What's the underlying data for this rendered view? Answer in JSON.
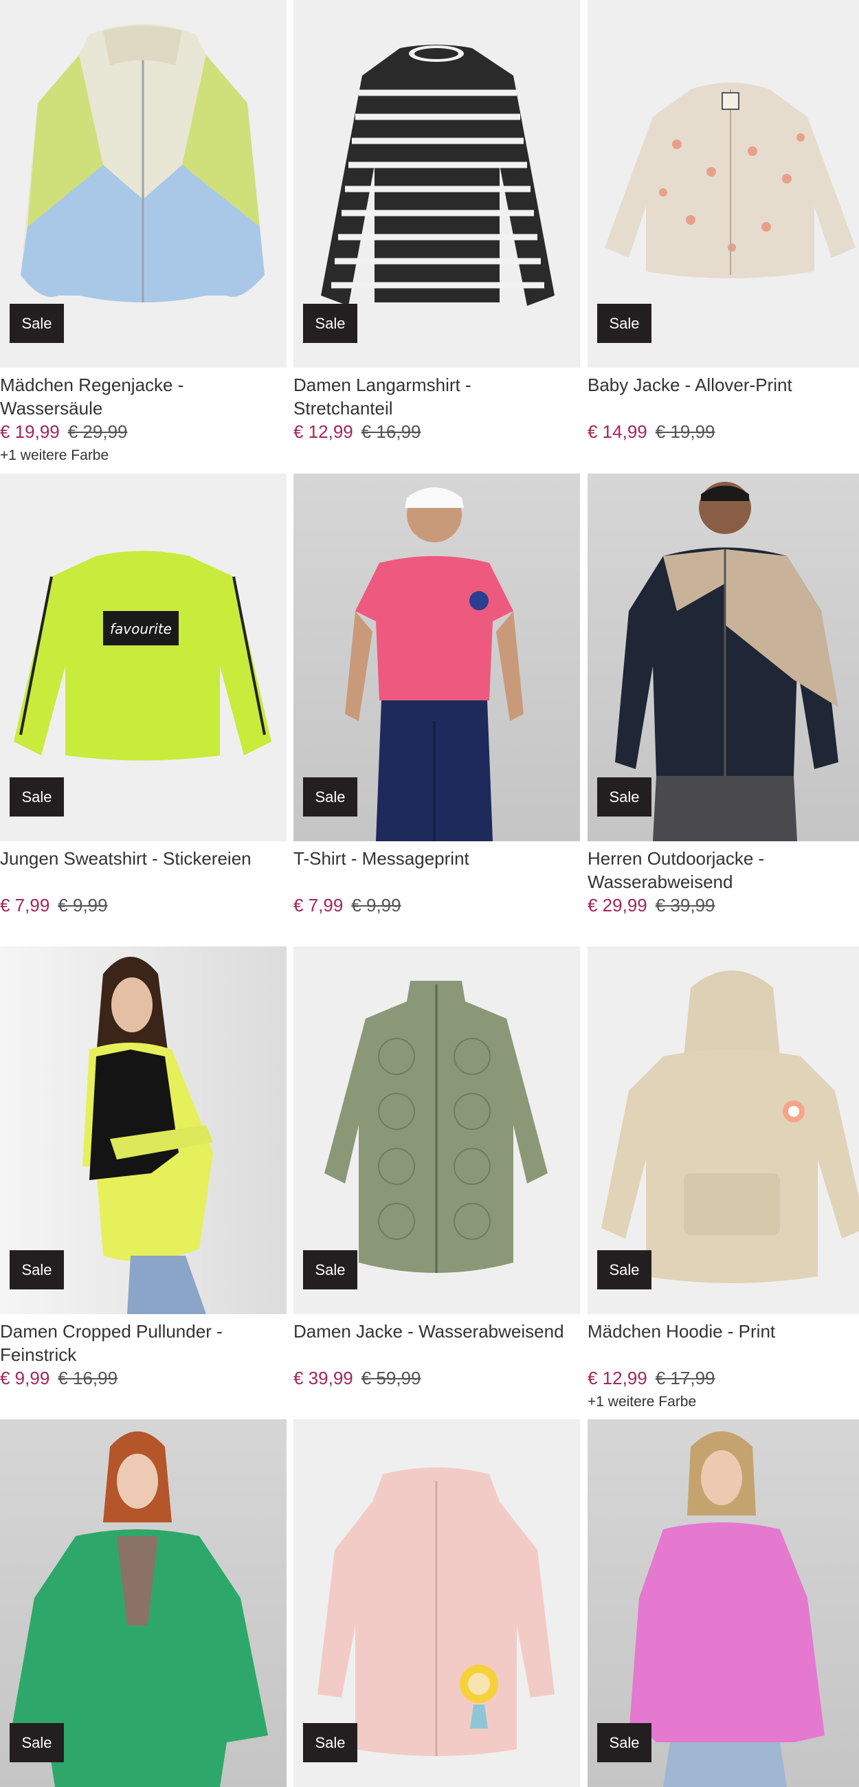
{
  "sale_label": "Sale",
  "products": [
    {
      "title": "Mädchen Regenjacke - Wassersäule",
      "price": "€ 19,99",
      "old_price": "€ 29,99",
      "more": "+1 weitere Farbe"
    },
    {
      "title": "Damen Langarmshirt - Stretchanteil",
      "price": "€ 12,99",
      "old_price": "€ 16,99",
      "more": ""
    },
    {
      "title": "Baby Jacke - Allover-Print",
      "price": "€ 14,99",
      "old_price": "€ 19,99",
      "more": ""
    },
    {
      "title": "Jungen Sweatshirt - Stickereien",
      "price": "€ 7,99",
      "old_price": "€ 9,99",
      "more": ""
    },
    {
      "title": "T-Shirt - Messageprint",
      "price": "€ 7,99",
      "old_price": "€ 9,99",
      "more": ""
    },
    {
      "title": "Herren Outdoorjacke - Wasserabweisend",
      "price": "€ 29,99",
      "old_price": "€ 39,99",
      "more": ""
    },
    {
      "title": "Damen Cropped Pullunder - Feinstrick",
      "price": "€ 9,99",
      "old_price": "€ 16,99",
      "more": ""
    },
    {
      "title": "Damen Jacke - Wasserabweisend",
      "price": "€ 39,99",
      "old_price": "€ 59,99",
      "more": ""
    },
    {
      "title": "Mädchen Hoodie - Print",
      "price": "€ 12,99",
      "old_price": "€ 17,99",
      "more": "+1 weitere Farbe"
    },
    {
      "title": "",
      "price": "",
      "old_price": "",
      "more": ""
    },
    {
      "title": "",
      "price": "",
      "old_price": "",
      "more": ""
    },
    {
      "title": "",
      "price": "",
      "old_price": "",
      "more": ""
    }
  ],
  "images": [
    {
      "icon": "rain-jacket-image"
    },
    {
      "icon": "striped-shirt-image"
    },
    {
      "icon": "quilted-baby-jacket-image"
    },
    {
      "icon": "sweatshirt-image"
    },
    {
      "icon": "tshirt-model-image"
    },
    {
      "icon": "outdoor-jacket-model-image"
    },
    {
      "icon": "pullunder-model-image"
    },
    {
      "icon": "quilted-jacket-image"
    },
    {
      "icon": "hoodie-image"
    },
    {
      "icon": "cardigan-model-image"
    },
    {
      "icon": "knit-baby-jacket-image"
    },
    {
      "icon": "pink-sweater-model-image"
    }
  ],
  "colors": {
    "price": "#a3265a",
    "badge": "#231f20"
  }
}
